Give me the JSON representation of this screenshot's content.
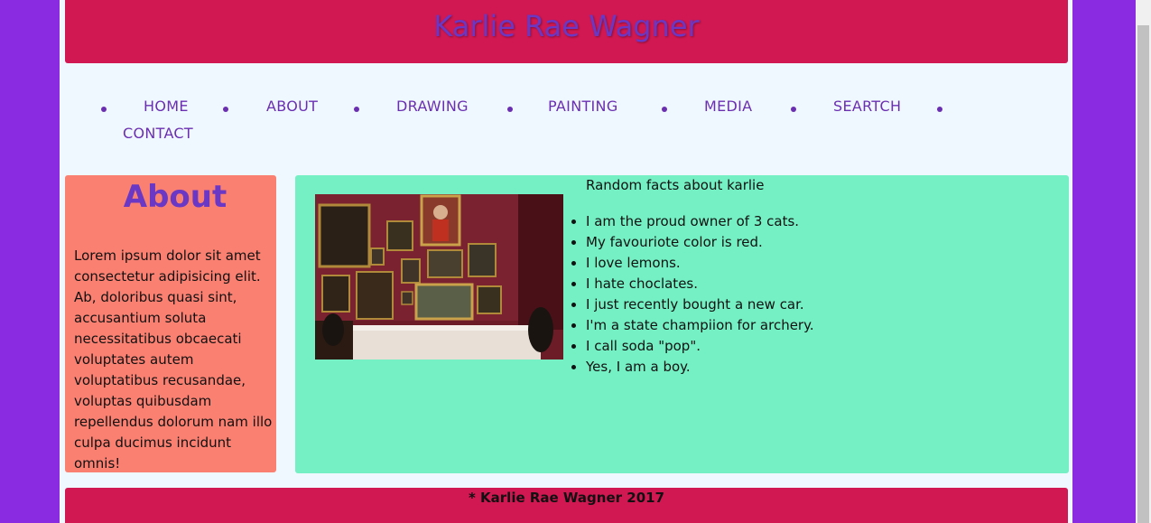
{
  "header": {
    "title": "Karlie Rae Wagner"
  },
  "nav": {
    "items": [
      {
        "label": "HOME"
      },
      {
        "label": "ABOUT"
      },
      {
        "label": "DRAWING"
      },
      {
        "label": "PAINTING"
      },
      {
        "label": "MEDIA"
      },
      {
        "label": "SEARTCH"
      },
      {
        "label": "CONTACT"
      }
    ]
  },
  "sidebar": {
    "heading": "About",
    "text": "Lorem ipsum dolor sit amet consectetur adipisicing elit. Ab, doloribus quasi sint, accusantium soluta necessitatibus obcaecati voluptates autem voluptatibus recusandae, voluptas quibusdam repellendus dolorum nam illo culpa ducimus incidunt omnis!"
  },
  "main": {
    "facts_title": "Random facts about karlie",
    "facts": [
      "I am the proud owner of 3 cats.",
      "My favouriote color is red.",
      "I love lemons.",
      "I hate choclates.",
      "I just recently bought a new car.",
      "I'm a state champiion for archery.",
      "I call soda \"pop\".",
      "Yes, I am a boy."
    ]
  },
  "footer": {
    "text": "* Karlie Rae Wagner 2017"
  },
  "colors": {
    "background": "#8a2be2",
    "page": "#f0f8ff",
    "header": "#d21852",
    "accent_text": "#6a38c4",
    "sidebar": "#fa8072",
    "main": "#74f0c4"
  }
}
